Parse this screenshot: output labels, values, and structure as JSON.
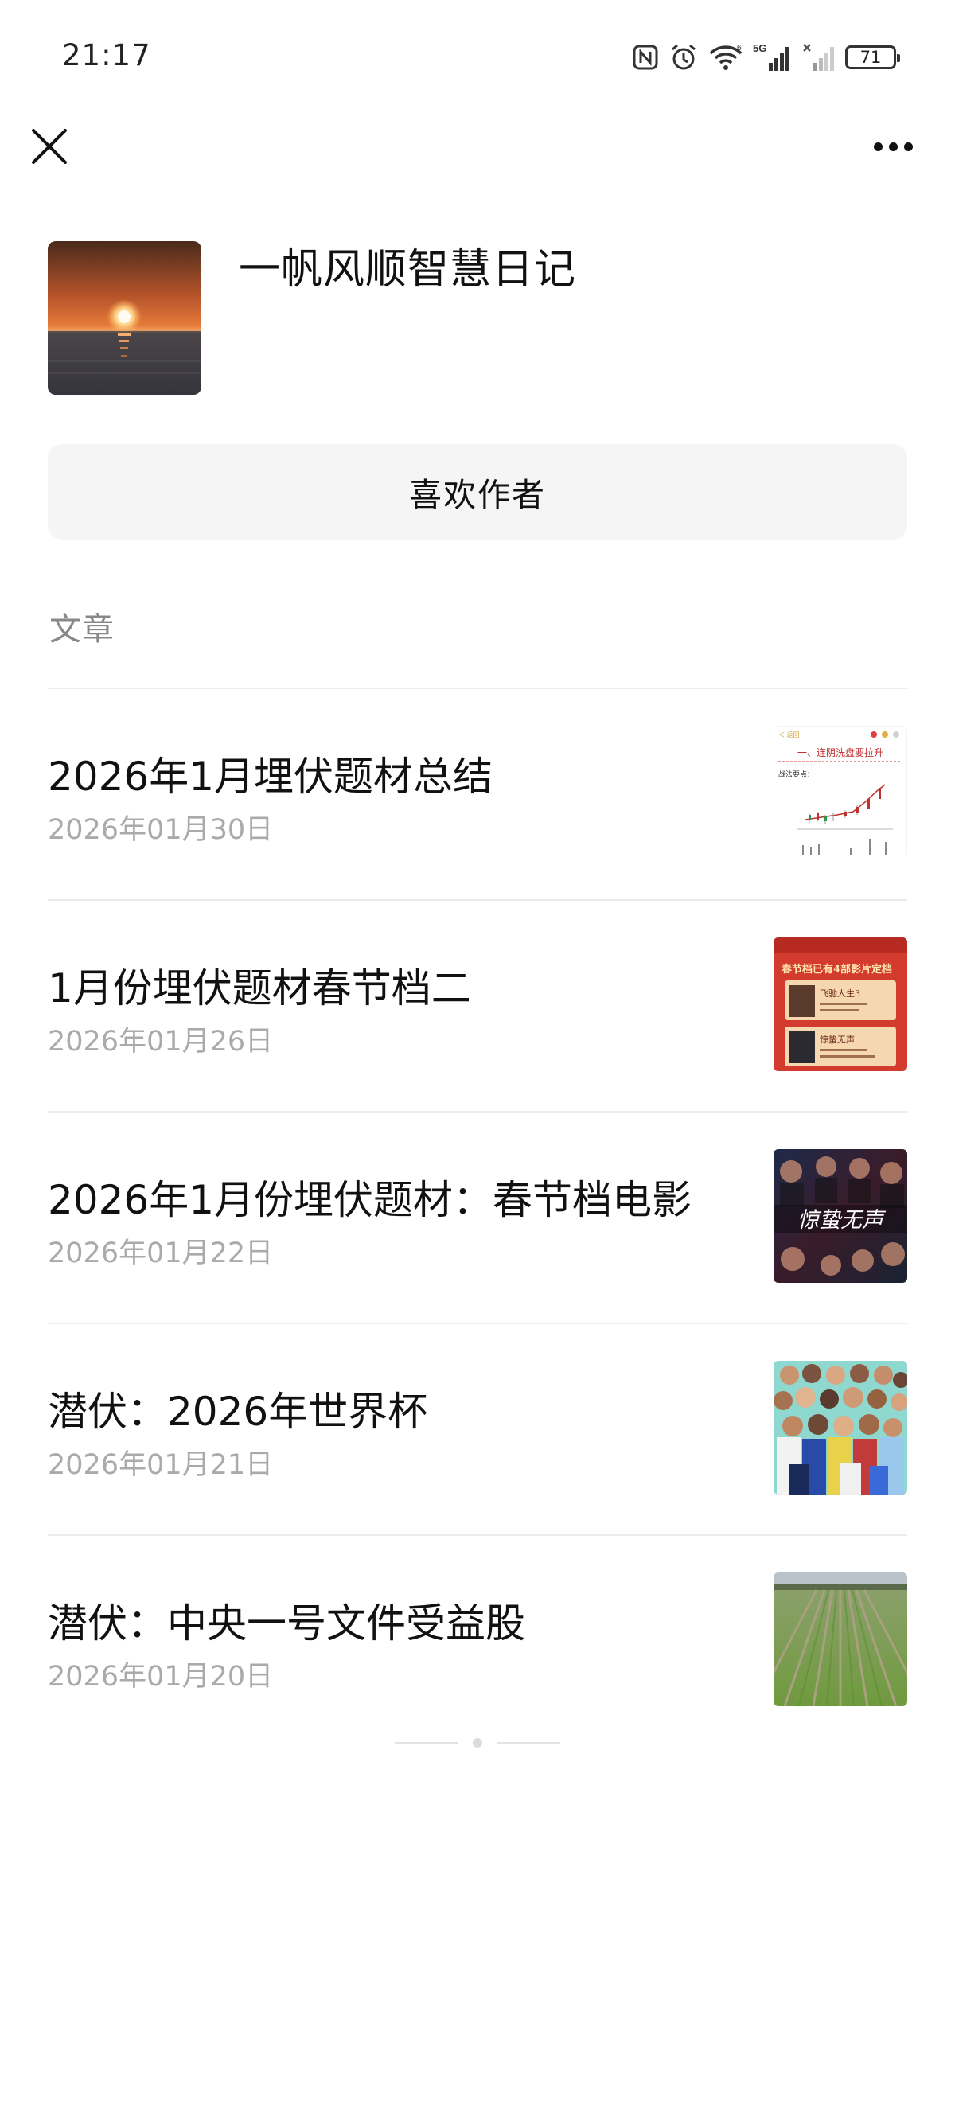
{
  "status_bar": {
    "time": "21:17",
    "battery": "71",
    "icons": [
      "nfc-icon",
      "alarm-icon",
      "wifi-icon",
      "signal-5g-icon",
      "signal-icon"
    ]
  },
  "nav": {
    "close_icon": "close-icon",
    "more_icon": "more-icon"
  },
  "profile": {
    "name": "一帆风顺智慧日记",
    "like_label": "喜欢作者"
  },
  "section": {
    "label": "文章"
  },
  "articles": [
    {
      "title": "2026年1月埋伏题材总结",
      "date": "2026年01月30日"
    },
    {
      "title": "1月份埋伏题材春节档二",
      "date": "2026年01月26日"
    },
    {
      "title": "2026年1月份埋伏题材：春节档电影",
      "date": "2026年01月22日"
    },
    {
      "title": "潜伏：2026年世界杯",
      "date": "2026年01月21日"
    },
    {
      "title": "潜伏：中央一号文件受益股",
      "date": "2026年01月20日"
    }
  ],
  "thumb1_texts": {
    "header": "一、连阴洗盘要拉升",
    "sub": "战法要点：",
    "back": "＜ 返回"
  },
  "thumb2_texts": {
    "top": "春节档已有4部影片定档",
    "movie1": "飞驰人生3",
    "movie2": "惊蛰无声"
  },
  "thumb3_texts": {
    "title": "惊蛰无声"
  }
}
